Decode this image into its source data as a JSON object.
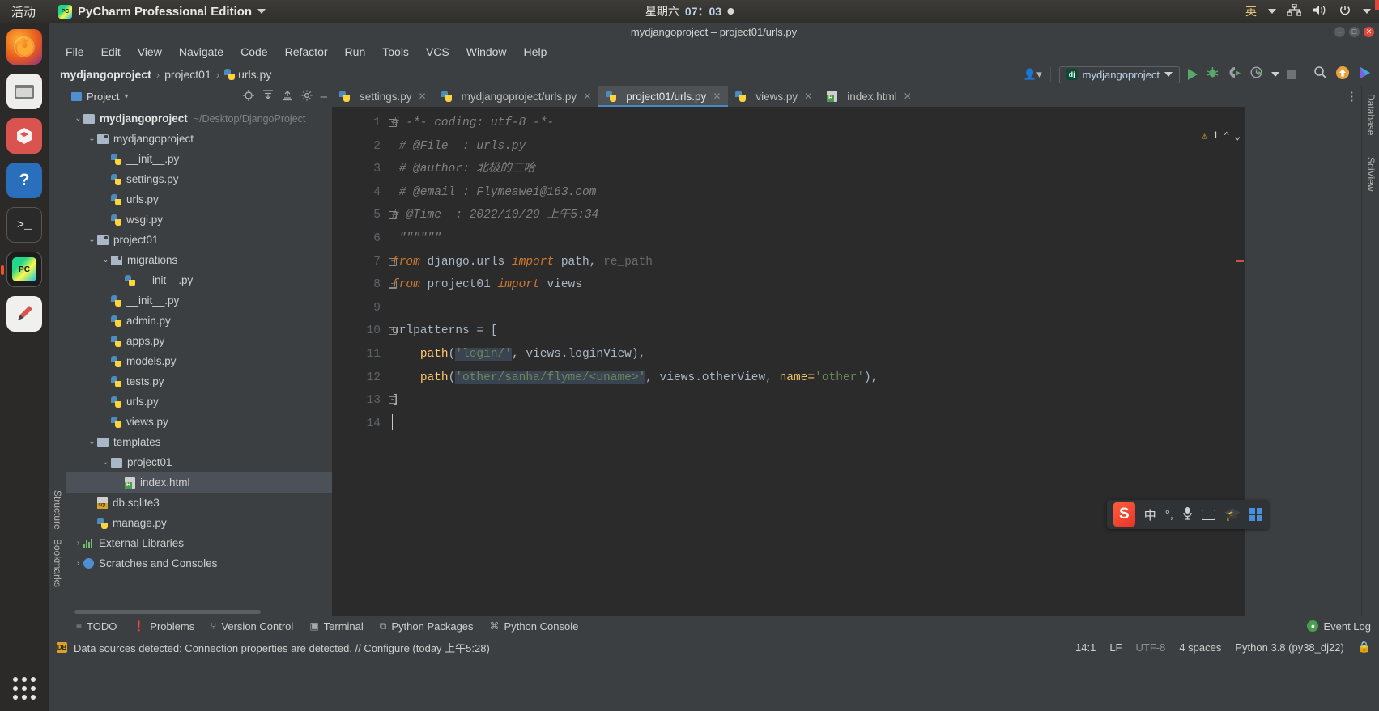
{
  "ubuntu": {
    "activities": "活动",
    "app_name": "PyCharm Professional Edition",
    "app_logo_text": "PC",
    "clock_weekday": "星期六",
    "clock_time": "07：03",
    "ime_label": "英",
    "network_icon": "network-icon",
    "volume_icon": "volume-icon",
    "power_icon": "power-icon"
  },
  "window": {
    "title": "mydjangoproject – project01/urls.py",
    "minimize": "–",
    "maximize": "□",
    "close": "✕"
  },
  "launcher": {
    "items": [
      {
        "name": "firefox",
        "glyph": ""
      },
      {
        "name": "files",
        "glyph": "🗄"
      },
      {
        "name": "software",
        "glyph": "A"
      },
      {
        "name": "help",
        "glyph": "?"
      },
      {
        "name": "terminal",
        "glyph": ">_"
      },
      {
        "name": "pycharm",
        "glyph": "PC"
      },
      {
        "name": "drawing",
        "glyph": "✏"
      }
    ],
    "show_apps": "show-applications"
  },
  "menu": {
    "items": [
      {
        "pre": "",
        "key": "F",
        "post": "ile"
      },
      {
        "pre": "",
        "key": "E",
        "post": "dit"
      },
      {
        "pre": "",
        "key": "V",
        "post": "iew"
      },
      {
        "pre": "",
        "key": "N",
        "post": "avigate"
      },
      {
        "pre": "",
        "key": "C",
        "post": "ode"
      },
      {
        "pre": "",
        "key": "R",
        "post": "efactor"
      },
      {
        "pre": "R",
        "key": "u",
        "post": "n"
      },
      {
        "pre": "",
        "key": "T",
        "post": "ools"
      },
      {
        "pre": "VC",
        "key": "S",
        "post": ""
      },
      {
        "pre": "",
        "key": "W",
        "post": "indow"
      },
      {
        "pre": "",
        "key": "H",
        "post": "elp"
      }
    ]
  },
  "navbar": {
    "crumbs": [
      "mydjangoproject",
      "project01",
      "urls.py"
    ],
    "separator": "›",
    "run_config": "mydjangoproject",
    "profile_icon": "user-profile-icon",
    "run_icon": "run-icon",
    "debug_icon": "debug-icon",
    "coverage_icon": "run-with-coverage-icon",
    "profiler_icon": "profiler-icon",
    "stop_icon": "stop-icon",
    "search_icon": "search-everywhere-icon",
    "update_icon": "update-icon",
    "ide_icon": "ide-feature-icon"
  },
  "project_panel": {
    "title": "Project",
    "dropdown": "▾",
    "toolbar_icons": [
      "locate-icon",
      "expand-all-icon",
      "collapse-all-icon",
      "settings-gear-icon",
      "hide-icon"
    ],
    "vertical_tabs": [
      "Project",
      "Structure",
      "Bookmarks"
    ],
    "tree": [
      {
        "indent": 0,
        "arrow": "⌄",
        "icon": "folder",
        "label": "mydjangoproject",
        "bold": true,
        "path": "~/Desktop/DjangoProject",
        "selected": false
      },
      {
        "indent": 1,
        "arrow": "⌄",
        "icon": "folder-module",
        "label": "mydjangoproject",
        "bold": false,
        "path": "",
        "selected": false
      },
      {
        "indent": 2,
        "arrow": "",
        "icon": "python",
        "label": "__init__.py",
        "bold": false,
        "path": "",
        "selected": false
      },
      {
        "indent": 2,
        "arrow": "",
        "icon": "python",
        "label": "settings.py",
        "bold": false,
        "path": "",
        "selected": false
      },
      {
        "indent": 2,
        "arrow": "",
        "icon": "python",
        "label": "urls.py",
        "bold": false,
        "path": "",
        "selected": false
      },
      {
        "indent": 2,
        "arrow": "",
        "icon": "python",
        "label": "wsgi.py",
        "bold": false,
        "path": "",
        "selected": false
      },
      {
        "indent": 1,
        "arrow": "⌄",
        "icon": "folder-module",
        "label": "project01",
        "bold": false,
        "path": "",
        "selected": false
      },
      {
        "indent": 2,
        "arrow": "⌄",
        "icon": "folder-module",
        "label": "migrations",
        "bold": false,
        "path": "",
        "selected": false
      },
      {
        "indent": 3,
        "arrow": "",
        "icon": "python",
        "label": "__init__.py",
        "bold": false,
        "path": "",
        "selected": false
      },
      {
        "indent": 2,
        "arrow": "",
        "icon": "python",
        "label": "__init__.py",
        "bold": false,
        "path": "",
        "selected": false
      },
      {
        "indent": 2,
        "arrow": "",
        "icon": "python",
        "label": "admin.py",
        "bold": false,
        "path": "",
        "selected": false
      },
      {
        "indent": 2,
        "arrow": "",
        "icon": "python",
        "label": "apps.py",
        "bold": false,
        "path": "",
        "selected": false
      },
      {
        "indent": 2,
        "arrow": "",
        "icon": "python",
        "label": "models.py",
        "bold": false,
        "path": "",
        "selected": false
      },
      {
        "indent": 2,
        "arrow": "",
        "icon": "python",
        "label": "tests.py",
        "bold": false,
        "path": "",
        "selected": false
      },
      {
        "indent": 2,
        "arrow": "",
        "icon": "python",
        "label": "urls.py",
        "bold": false,
        "path": "",
        "selected": false
      },
      {
        "indent": 2,
        "arrow": "",
        "icon": "python",
        "label": "views.py",
        "bold": false,
        "path": "",
        "selected": false
      },
      {
        "indent": 1,
        "arrow": "⌄",
        "icon": "folder",
        "label": "templates",
        "bold": false,
        "path": "",
        "selected": false
      },
      {
        "indent": 2,
        "arrow": "⌄",
        "icon": "folder",
        "label": "project01",
        "bold": false,
        "path": "",
        "selected": false
      },
      {
        "indent": 3,
        "arrow": "",
        "icon": "html",
        "label": "index.html",
        "bold": false,
        "path": "",
        "selected": true
      },
      {
        "indent": 1,
        "arrow": "",
        "icon": "sqlite",
        "label": "db.sqlite3",
        "bold": false,
        "path": "",
        "selected": false
      },
      {
        "indent": 1,
        "arrow": "",
        "icon": "python",
        "label": "manage.py",
        "bold": false,
        "path": "",
        "selected": false
      },
      {
        "indent": 0,
        "arrow": "›",
        "icon": "library",
        "label": "External Libraries",
        "bold": false,
        "path": "",
        "selected": false
      },
      {
        "indent": 0,
        "arrow": "›",
        "icon": "scratch",
        "label": "Scratches and Consoles",
        "bold": false,
        "path": "",
        "selected": false
      }
    ]
  },
  "editor": {
    "tabs": [
      {
        "label": "settings.py",
        "icon": "python",
        "active": false
      },
      {
        "label": "mydjangoproject/urls.py",
        "icon": "python",
        "active": false
      },
      {
        "label": "project01/urls.py",
        "icon": "python",
        "active": true
      },
      {
        "label": "views.py",
        "icon": "python",
        "active": false
      },
      {
        "label": "index.html",
        "icon": "html",
        "active": false
      }
    ],
    "close_glyph": "✕",
    "warning_count": "1",
    "warning_icon": "warning-triangle-icon",
    "up_arrow": "⌃",
    "down_arrow": "⌄",
    "more_icon": "more-options-icon",
    "line_numbers": [
      "1",
      "2",
      "3",
      "4",
      "5",
      "6",
      "7",
      "8",
      "9",
      "10",
      "11",
      "12",
      "13",
      "14"
    ],
    "lines": [
      {
        "n": 1,
        "fold": "start",
        "tokens": [
          {
            "t": "cmt",
            "v": "# -*- coding: utf-8 -*-"
          }
        ]
      },
      {
        "n": 2,
        "fold": "",
        "tokens": [
          {
            "t": "cmt",
            "v": " # @File  : urls.py"
          }
        ]
      },
      {
        "n": 3,
        "fold": "",
        "tokens": [
          {
            "t": "cmt",
            "v": " # @author: 北极的三哈"
          }
        ]
      },
      {
        "n": 4,
        "fold": "",
        "tokens": [
          {
            "t": "cmt",
            "v": " # @email : Flymeawei@163.com"
          }
        ]
      },
      {
        "n": 5,
        "fold": "end",
        "tokens": [
          {
            "t": "cmt",
            "v": "# @Time  : 2022/10/29 上午5:34"
          }
        ]
      },
      {
        "n": 6,
        "fold": "",
        "tokens": [
          {
            "t": "cmt",
            "v": " \"\"\"\"\"\""
          }
        ]
      },
      {
        "n": 7,
        "fold": "start",
        "tokens": [
          {
            "t": "kwi",
            "v": "from"
          },
          {
            "t": "def",
            "v": " django.urls "
          },
          {
            "t": "kwi",
            "v": "import"
          },
          {
            "t": "def",
            "v": " path, "
          },
          {
            "t": "grey",
            "v": "re_path"
          }
        ]
      },
      {
        "n": 8,
        "fold": "end",
        "tokens": [
          {
            "t": "kwi",
            "v": "from"
          },
          {
            "t": "def",
            "v": " project01 "
          },
          {
            "t": "kwi",
            "v": "import"
          },
          {
            "t": "def",
            "v": " views"
          }
        ]
      },
      {
        "n": 9,
        "fold": "",
        "tokens": [
          {
            "t": "def",
            "v": ""
          }
        ]
      },
      {
        "n": 10,
        "fold": "start",
        "tokens": [
          {
            "t": "def",
            "v": "urlpatterns = ["
          }
        ]
      },
      {
        "n": 11,
        "fold": "",
        "tokens": [
          {
            "t": "def",
            "v": "    "
          },
          {
            "t": "fn",
            "v": "path"
          },
          {
            "t": "def",
            "v": "("
          },
          {
            "t": "strsel",
            "v": "'login/'"
          },
          {
            "t": "def",
            "v": ", views.loginView),"
          }
        ]
      },
      {
        "n": 12,
        "fold": "",
        "tokens": [
          {
            "t": "def",
            "v": "    "
          },
          {
            "t": "fn",
            "v": "path"
          },
          {
            "t": "def",
            "v": "("
          },
          {
            "t": "strsel",
            "v": "'other/sanha/flyme/<uname>'"
          },
          {
            "t": "def",
            "v": ", views.otherView, "
          },
          {
            "t": "named",
            "v": "name="
          },
          {
            "t": "str",
            "v": "'other'"
          },
          {
            "t": "def",
            "v": "),"
          }
        ]
      },
      {
        "n": 13,
        "fold": "end",
        "tokens": [
          {
            "t": "def",
            "v": "]"
          }
        ]
      },
      {
        "n": 14,
        "fold": "",
        "tokens": [
          {
            "t": "caret",
            "v": ""
          }
        ]
      }
    ]
  },
  "right_strip": {
    "tabs": [
      "Database",
      "SciView"
    ]
  },
  "ime_bar": {
    "logo": "S",
    "mode": "中",
    "punct": "°,",
    "mic_icon": "microphone-icon",
    "keyboard_icon": "keyboard-icon",
    "hat_icon": "graduation-hat-icon",
    "grid_icon": "app-grid-icon"
  },
  "bottom_tools": {
    "items": [
      {
        "label": "TODO",
        "icon": "todo-icon"
      },
      {
        "label": "Problems",
        "icon": "problems-icon"
      },
      {
        "label": "Version Control",
        "icon": "version-control-icon"
      },
      {
        "label": "Terminal",
        "icon": "terminal-icon"
      },
      {
        "label": "Python Packages",
        "icon": "python-packages-icon"
      },
      {
        "label": "Python Console",
        "icon": "python-console-icon"
      }
    ],
    "event_log": "Event Log"
  },
  "status_bar": {
    "message": "Data sources detected: Connection properties are detected. // Configure (today 上午5:28)",
    "caret_position": "14:1",
    "line_separator": "LF",
    "encoding": "UTF-8",
    "indent": "4 spaces",
    "interpreter": "Python 3.8 (py38_dj22)",
    "lock_icon": "lock-icon"
  }
}
